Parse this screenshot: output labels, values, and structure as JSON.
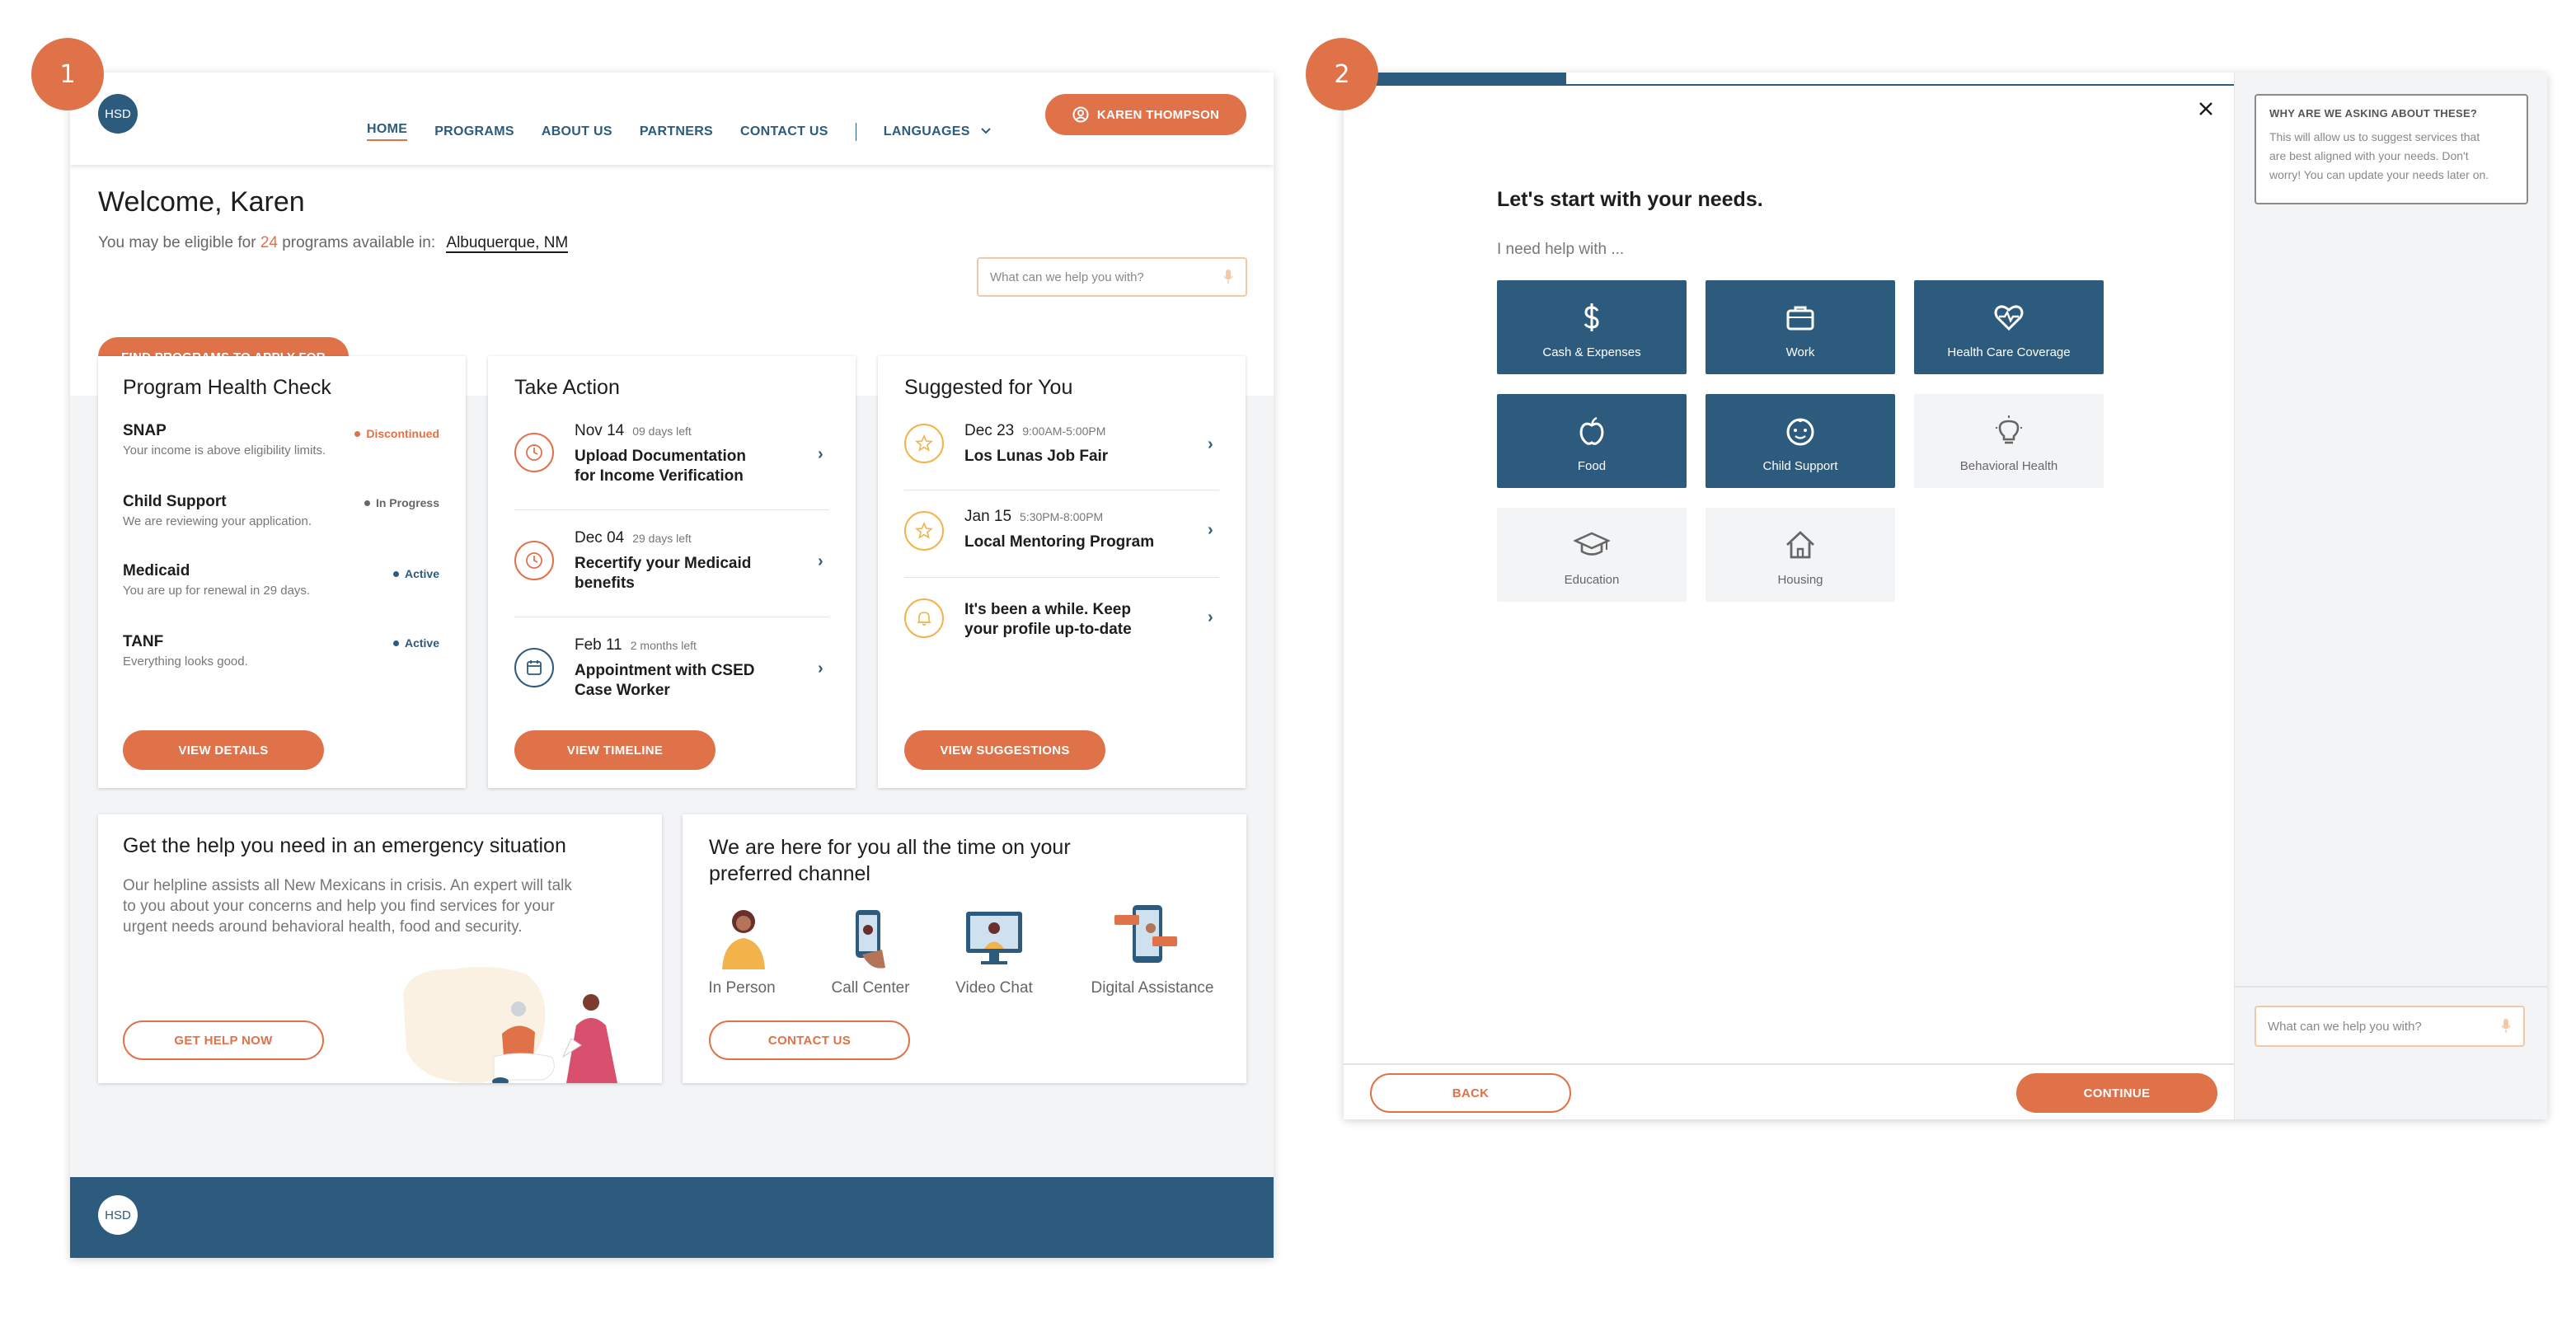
{
  "badges": {
    "one": "1",
    "two": "2"
  },
  "colors": {
    "accent": "#e0724a",
    "brand": "#2d5b7e",
    "bg": "#f3f4f6",
    "success": "#2d5b7e",
    "danger": "#e0724a",
    "neutral": "#666666"
  },
  "screen1": {
    "logo": "HSD",
    "nav": [
      {
        "label": "HOME",
        "active": true
      },
      {
        "label": "PROGRAMS"
      },
      {
        "label": "ABOUT US"
      },
      {
        "label": "PARTNERS"
      },
      {
        "label": "CONTACT US"
      },
      {
        "label": "LANGUAGES"
      }
    ],
    "user_button": "KAREN THOMPSON",
    "welcome_title": "Welcome, Karen",
    "eligible_prefix": "You may be eligible for",
    "eligible_count": "24",
    "eligible_mid": "programs available in:",
    "location": "Albuquerque, NM",
    "find_button": "FIND PROGRAMS TO APPLY FOR",
    "search_placeholder": "What can we help you with?",
    "health_check": {
      "title": "Program Health Check",
      "items": [
        {
          "name": "SNAP",
          "desc": "Your income is above eligibility limits.",
          "status": "Discontinued"
        },
        {
          "name": "Child Support",
          "desc": "We are reviewing your application.",
          "status": "In Progress"
        },
        {
          "name": "Medicaid",
          "desc": "You are up for renewal in 29 days.",
          "status": "Active"
        },
        {
          "name": "TANF",
          "desc": "Everything looks good.",
          "status": "Active"
        }
      ],
      "button": "VIEW DETAILS"
    },
    "take_action": {
      "title": "Take Action",
      "items": [
        {
          "date": "Nov 14",
          "left": "09 days left",
          "title1": "Upload Documentation",
          "title2": "for Income Verification",
          "icon": "clock-icon"
        },
        {
          "date": "Dec 04",
          "left": "29 days left",
          "title1": "Recertify your Medicaid",
          "title2": "benefits",
          "icon": "clock-icon"
        },
        {
          "date": "Feb 11",
          "left": "2 months left",
          "title1": "Appointment with CSED",
          "title2": "Case Worker",
          "icon": "calendar-icon"
        }
      ],
      "button": "VIEW TIMELINE"
    },
    "suggested": {
      "title": "Suggested for You",
      "items": [
        {
          "date": "Dec 23",
          "time": "9:00AM-5:00PM",
          "title1": "Los Lunas Job Fair",
          "title2": "",
          "icon": "star-icon"
        },
        {
          "date": "Jan 15",
          "time": "5:30PM-8:00PM",
          "title1": "Local Mentoring Program",
          "title2": "",
          "icon": "star-icon"
        },
        {
          "date": "",
          "time": "",
          "title1": "It's been a while. Keep",
          "title2": "your profile up-to-date",
          "icon": "bell-icon"
        }
      ],
      "button": "VIEW SUGGESTIONS"
    },
    "emergency": {
      "title": "Get the help you need in an emergency situation",
      "line1": "Our helpline assists all New Mexicans in crisis. An expert will talk",
      "line2": "to you about your concerns and help you find services for your",
      "line3": "urgent needs around behavioral health, food and security.",
      "button": "GET HELP NOW"
    },
    "channels": {
      "title1": "We are here for you all the time on your",
      "title2": "preferred channel",
      "items": [
        {
          "label": "In Person"
        },
        {
          "label": "Call Center"
        },
        {
          "label": "Video Chat"
        },
        {
          "label": "Digital Assistance"
        }
      ],
      "button": "CONTACT US"
    },
    "footer_logo": "HSD"
  },
  "screen2": {
    "progress_fraction": 0.25,
    "heading": "Let's start with your needs.",
    "subheading": "I need help with ...",
    "needs": [
      {
        "label": "Cash & Expenses",
        "selected": true,
        "icon": "dollar-icon"
      },
      {
        "label": "Work",
        "selected": true,
        "icon": "briefcase-icon"
      },
      {
        "label": "Health Care Coverage",
        "selected": true,
        "icon": "heart-pulse-icon"
      },
      {
        "label": "Food",
        "selected": true,
        "icon": "apple-icon"
      },
      {
        "label": "Child Support",
        "selected": true,
        "icon": "baby-face-icon"
      },
      {
        "label": "Behavioral Health",
        "selected": false,
        "icon": "lightbulb-icon"
      },
      {
        "label": "Education",
        "selected": false,
        "icon": "graduation-cap-icon"
      },
      {
        "label": "Housing",
        "selected": false,
        "icon": "house-icon"
      }
    ],
    "why_title": "WHY ARE WE ASKING ABOUT THESE?",
    "why_line1": "This will allow us to suggest services that",
    "why_line2": "are best aligned with your needs. Don't",
    "why_line3": "worry! You can update your needs later on.",
    "search_placeholder": "What can we help you with?",
    "back_button": "BACK",
    "continue_button": "CONTINUE"
  }
}
